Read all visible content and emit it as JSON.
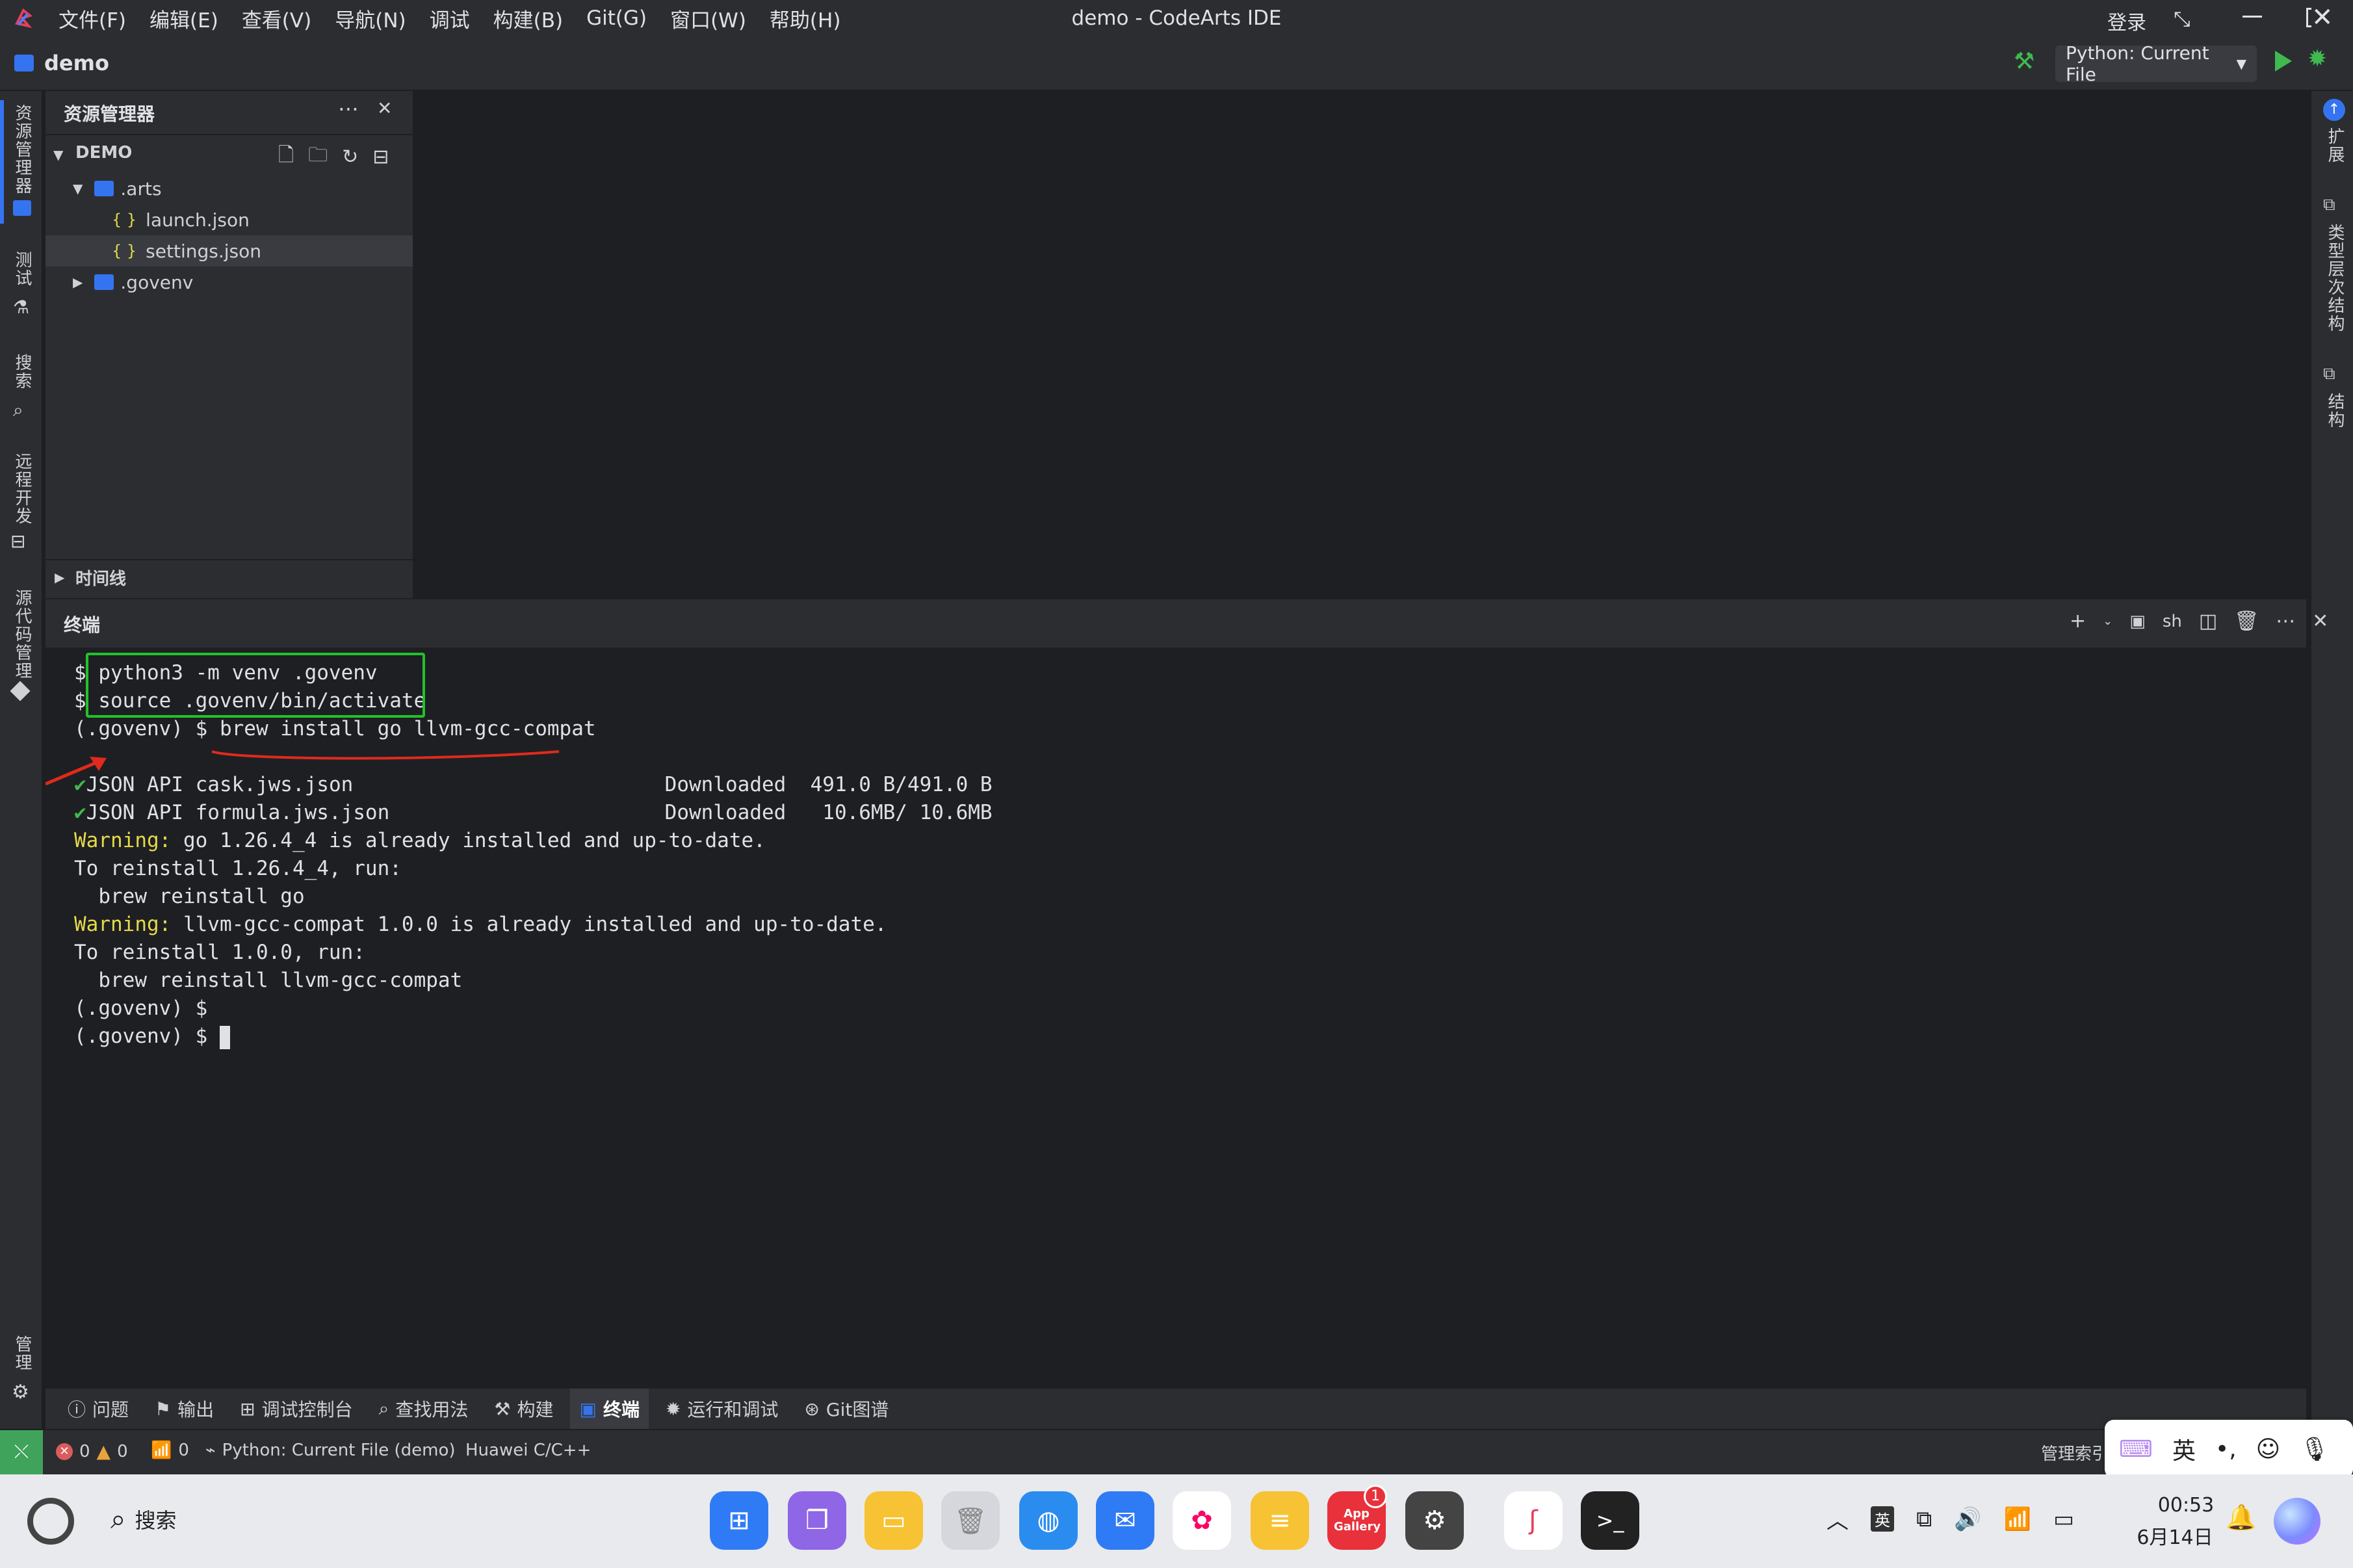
{
  "titlebar": {
    "menu": [
      "文件(F)",
      "编辑(E)",
      "查看(V)",
      "导航(N)",
      "调试",
      "构建(B)",
      "Git(G)",
      "窗口(W)",
      "帮助(H)"
    ],
    "title": "demo - CodeArts IDE",
    "login": "登录"
  },
  "project": {
    "name": "demo",
    "run_config": "Python: Current File"
  },
  "left_strip": [
    "资源管理器",
    "测试",
    "搜索",
    "远程开发",
    "源代码管理",
    "管理"
  ],
  "right_strip": [
    "扩展",
    "类型层次结构",
    "结构"
  ],
  "explorer": {
    "title": "资源管理器",
    "root": "DEMO",
    "items": [
      ".arts",
      "launch.json",
      "settings.json",
      ".govenv"
    ],
    "timeline": "时间线"
  },
  "terminal": {
    "title": "终端",
    "shell": "sh",
    "lines": [
      {
        "prompt": "$ ",
        "text": "python3 -m venv .govenv"
      },
      {
        "prompt": "$ ",
        "text": "source .govenv/bin/activate"
      },
      {
        "prompt": "(.govenv) $ ",
        "text": "brew install go llvm-gcc-compat"
      },
      {
        "prompt": "",
        "text": ""
      },
      {
        "check": "✔",
        "text": "JSON API cask.jws.json",
        "status": "Downloaded  491.0 B/491.0 B"
      },
      {
        "check": "✔",
        "text": "JSON API formula.jws.json",
        "status": "Downloaded   10.6MB/ 10.6MB"
      },
      {
        "warn": "Warning:",
        "text": " go 1.26.4_4 is already installed and up-to-date."
      },
      {
        "prompt": "",
        "text": "To reinstall 1.26.4_4, run:"
      },
      {
        "prompt": "",
        "text": "  brew reinstall go"
      },
      {
        "warn": "Warning:",
        "text": " llvm-gcc-compat 1.0.0 is already installed and up-to-date."
      },
      {
        "prompt": "",
        "text": "To reinstall 1.0.0, run:"
      },
      {
        "prompt": "",
        "text": "  brew reinstall llvm-gcc-compat"
      },
      {
        "prompt": "(.govenv) $ ",
        "text": ""
      },
      {
        "prompt": "(.govenv) $ ",
        "text": "",
        "cursor": true
      }
    ]
  },
  "bottom_tabs": [
    "问题",
    "输出",
    "调试控制台",
    "查找用法",
    "构建",
    "终端",
    "运行和调试",
    "Git图谱"
  ],
  "statusbar": {
    "errors": "0",
    "warnings": "0",
    "ports": "0",
    "run": "Python: Current File (demo)",
    "lang": "Huawei C/C++",
    "right": "管理索引"
  },
  "ime": {
    "lang": "英",
    "punct": "•,"
  },
  "taskbar": {
    "search": "搜索",
    "badge": "1",
    "appgallery": "App Gallery",
    "ime": "英",
    "time": "00:53",
    "date": "6月14日"
  },
  "colors": {
    "accent": "#3574f0",
    "green_box": "#22c22a",
    "red_mark": "#e02a1d",
    "warning": "#e5d94a",
    "check": "#3fb950"
  }
}
